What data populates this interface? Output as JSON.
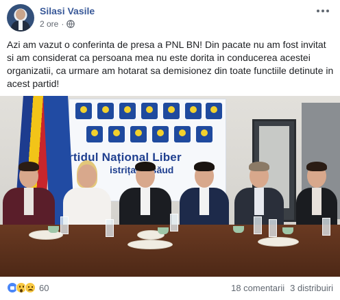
{
  "post": {
    "author": "Silasi Vasile",
    "time": "2 ore",
    "separator": "·",
    "text": "Azi am vazut o conferinta de presa a PNL BN! Din pacate nu am fost invitat si am considerat ca persoana mea nu este dorita in conducerea acestei organizatii, ca urmare am hotarat sa demisionez din toate functiile detinute in acest partid!"
  },
  "photo": {
    "banner_title": "rtidul Național Liber",
    "banner_sub": "istrița-Năsăud",
    "logo_label": "PNL"
  },
  "footer": {
    "reactions": [
      "like-icon",
      "wow-icon",
      "sad-icon"
    ],
    "reaction_count": "60",
    "comments": "18 comentarii",
    "shares": "3 distribuiri"
  },
  "colors": {
    "author": "#385898",
    "meta": "#616770",
    "like": "#4a86f7",
    "emoji": "#f7c742",
    "party_blue": "#1f3f8f"
  }
}
